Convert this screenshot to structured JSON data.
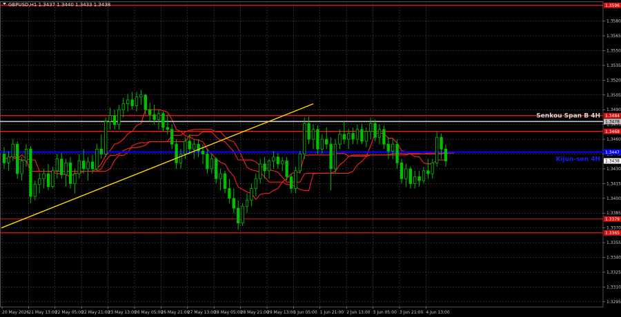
{
  "chart_data": {
    "type": "candlestick",
    "title": "GBPUSD,H1  1.3437 1.3440 1.3433 1.3438",
    "ylim": [
      1.329,
      1.36
    ],
    "y_ticks": [
      "1.3580",
      "1.3565",
      "1.3550",
      "1.3535",
      "1.3520",
      "1.3505",
      "1.3490",
      "1.3475",
      "1.3460",
      "1.3445",
      "1.3430",
      "1.3415",
      "1.3400",
      "1.3385",
      "1.3370",
      "1.3355",
      "1.3340",
      "1.3325",
      "1.3310",
      "1.3295"
    ],
    "x_ticks": [
      "20 May 2026",
      "21 May 13:00",
      "22 May 05:00",
      "22 May 21:00",
      "23 May 13:00",
      "26 May 05:00",
      "26 May 21:00",
      "27 May 13:00",
      "28 May 05:00",
      "28 May 21:00",
      "29 May 13:00",
      "1 Jun 05:00",
      "1 Jun 21:00",
      "2 Jun 13:00",
      "3 Jun 05:00",
      "3 Jun 21:00",
      "4 Jun 13:00"
    ],
    "levels": [
      {
        "price": 1.3596,
        "label": "1.3596",
        "color": "#ff1a1a",
        "width": 1.2
      },
      {
        "price": 1.3484,
        "label": "1.3484",
        "color": "#ff1a1a",
        "width": 1.2
      },
      {
        "price": 1.3468,
        "label": "1.3468",
        "color": "#ff1a1a",
        "width": 1.2
      },
      {
        "price": 1.3379,
        "label": "1.3379",
        "color": "#ff1a1a",
        "width": 0.8
      },
      {
        "price": 1.3365,
        "label": "1.3365",
        "color": "#ff1a1a",
        "width": 1.2
      }
    ],
    "senkou": {
      "price": 1.3478,
      "label": "Senkou Span B 4H",
      "badge": "1.3478",
      "color": "#c8c8c8"
    },
    "kijun": {
      "price": 1.3447,
      "label": "Kijun-sen 4H",
      "badge": "1.3447",
      "color": "#0000ff"
    },
    "current_price": {
      "price": 1.3438,
      "label": "1.3438"
    },
    "trendline": {
      "from": [
        0,
        1.337
      ],
      "to": [
        70,
        1.3496
      ],
      "color": "#ffd700"
    },
    "candle_colors": {
      "up": "#00c000",
      "down": "#00c000"
    },
    "candles": [
      [
        1.3445,
        1.3452,
        1.343,
        1.3436
      ],
      [
        1.3436,
        1.3448,
        1.3428,
        1.3442
      ],
      [
        1.3442,
        1.346,
        1.3438,
        1.3455
      ],
      [
        1.3455,
        1.3458,
        1.342,
        1.3425
      ],
      [
        1.3425,
        1.3442,
        1.3418,
        1.3438
      ],
      [
        1.3438,
        1.3455,
        1.3432,
        1.345
      ],
      [
        1.345,
        1.3453,
        1.3395,
        1.3402
      ],
      [
        1.3402,
        1.3418,
        1.3398,
        1.3414
      ],
      [
        1.3414,
        1.3426,
        1.3405,
        1.342
      ],
      [
        1.342,
        1.343,
        1.341,
        1.3425
      ],
      [
        1.3425,
        1.3435,
        1.3408,
        1.3412
      ],
      [
        1.3412,
        1.3432,
        1.341,
        1.3428
      ],
      [
        1.3428,
        1.3445,
        1.342,
        1.344
      ],
      [
        1.344,
        1.3446,
        1.342,
        1.3424
      ],
      [
        1.3424,
        1.344,
        1.3412,
        1.3436
      ],
      [
        1.3436,
        1.3442,
        1.341,
        1.3415
      ],
      [
        1.3415,
        1.343,
        1.3405,
        1.3425
      ],
      [
        1.3425,
        1.3445,
        1.342,
        1.3438
      ],
      [
        1.3438,
        1.345,
        1.3425,
        1.343
      ],
      [
        1.343,
        1.3442,
        1.3418,
        1.3437
      ],
      [
        1.3437,
        1.3444,
        1.3425,
        1.343
      ],
      [
        1.343,
        1.3455,
        1.3428,
        1.345
      ],
      [
        1.345,
        1.3465,
        1.344,
        1.3445
      ],
      [
        1.3445,
        1.3482,
        1.3442,
        1.3478
      ],
      [
        1.3478,
        1.3492,
        1.347,
        1.3484
      ],
      [
        1.3484,
        1.349,
        1.347,
        1.3475
      ],
      [
        1.3475,
        1.3495,
        1.347,
        1.349
      ],
      [
        1.349,
        1.3502,
        1.3482,
        1.3496
      ],
      [
        1.3496,
        1.3506,
        1.3488,
        1.35
      ],
      [
        1.35,
        1.3508,
        1.349,
        1.3494
      ],
      [
        1.3494,
        1.3508,
        1.3488,
        1.3503
      ],
      [
        1.3503,
        1.351,
        1.3495,
        1.3505
      ],
      [
        1.3505,
        1.3506,
        1.3485,
        1.349
      ],
      [
        1.349,
        1.3497,
        1.3478,
        1.3485
      ],
      [
        1.3485,
        1.3495,
        1.3475,
        1.348
      ],
      [
        1.348,
        1.349,
        1.347,
        1.3486
      ],
      [
        1.3486,
        1.3488,
        1.3468,
        1.3472
      ],
      [
        1.3472,
        1.3485,
        1.3465,
        1.347
      ],
      [
        1.347,
        1.3475,
        1.345,
        1.3455
      ],
      [
        1.3455,
        1.346,
        1.343,
        1.3436
      ],
      [
        1.3436,
        1.345,
        1.343,
        1.3445
      ],
      [
        1.3445,
        1.3462,
        1.344,
        1.3458
      ],
      [
        1.3458,
        1.3465,
        1.3445,
        1.345
      ],
      [
        1.345,
        1.346,
        1.344,
        1.3455
      ],
      [
        1.3455,
        1.346,
        1.3442,
        1.3448
      ],
      [
        1.3448,
        1.3455,
        1.3435,
        1.3445
      ],
      [
        1.3445,
        1.345,
        1.3425,
        1.343
      ],
      [
        1.343,
        1.3445,
        1.3425,
        1.344
      ],
      [
        1.344,
        1.3442,
        1.3415,
        1.342
      ],
      [
        1.342,
        1.343,
        1.3408,
        1.3425
      ],
      [
        1.3425,
        1.3428,
        1.3405,
        1.341
      ],
      [
        1.341,
        1.342,
        1.3395,
        1.34
      ],
      [
        1.34,
        1.341,
        1.3385,
        1.339
      ],
      [
        1.339,
        1.3398,
        1.3368,
        1.3375
      ],
      [
        1.3375,
        1.3395,
        1.3372,
        1.3392
      ],
      [
        1.3392,
        1.3405,
        1.3385,
        1.3398
      ],
      [
        1.3398,
        1.3415,
        1.3392,
        1.341
      ],
      [
        1.341,
        1.3425,
        1.3402,
        1.342
      ],
      [
        1.342,
        1.344,
        1.3415,
        1.3435
      ],
      [
        1.3435,
        1.3442,
        1.342,
        1.3428
      ],
      [
        1.3428,
        1.344,
        1.342,
        1.3438
      ],
      [
        1.3438,
        1.3448,
        1.343,
        1.3442
      ],
      [
        1.3442,
        1.3446,
        1.343,
        1.3435
      ],
      [
        1.3435,
        1.3442,
        1.3428,
        1.3438
      ],
      [
        1.3438,
        1.3442,
        1.3418,
        1.3422
      ],
      [
        1.3422,
        1.3425,
        1.3405,
        1.341
      ],
      [
        1.341,
        1.3432,
        1.3405,
        1.3428
      ],
      [
        1.3428,
        1.3448,
        1.3425,
        1.3445
      ],
      [
        1.3445,
        1.3482,
        1.344,
        1.3476
      ],
      [
        1.3476,
        1.3483,
        1.3455,
        1.346
      ],
      [
        1.346,
        1.3475,
        1.345,
        1.347
      ],
      [
        1.347,
        1.3474,
        1.3445,
        1.345
      ],
      [
        1.345,
        1.3465,
        1.3445,
        1.346
      ],
      [
        1.346,
        1.3472,
        1.345,
        1.3455
      ],
      [
        1.3455,
        1.3462,
        1.3408,
        1.343
      ],
      [
        1.343,
        1.346,
        1.3425,
        1.3455
      ],
      [
        1.3455,
        1.347,
        1.345,
        1.3465
      ],
      [
        1.3465,
        1.3478,
        1.3455,
        1.346
      ],
      [
        1.346,
        1.347,
        1.345,
        1.3466
      ],
      [
        1.3466,
        1.3472,
        1.3455,
        1.346
      ],
      [
        1.346,
        1.3475,
        1.3455,
        1.347
      ],
      [
        1.347,
        1.3476,
        1.3455,
        1.3458
      ],
      [
        1.3458,
        1.3472,
        1.3452,
        1.3468
      ],
      [
        1.3468,
        1.3482,
        1.346,
        1.3476
      ],
      [
        1.3476,
        1.348,
        1.3458,
        1.3462
      ],
      [
        1.3462,
        1.3475,
        1.3455,
        1.347
      ],
      [
        1.347,
        1.3474,
        1.345,
        1.3455
      ],
      [
        1.3455,
        1.3462,
        1.344,
        1.3448
      ],
      [
        1.3448,
        1.346,
        1.344,
        1.3455
      ],
      [
        1.3455,
        1.346,
        1.343,
        1.3436
      ],
      [
        1.3436,
        1.344,
        1.3415,
        1.342
      ],
      [
        1.342,
        1.3435,
        1.3412,
        1.343
      ],
      [
        1.343,
        1.3432,
        1.341,
        1.3415
      ],
      [
        1.3415,
        1.3428,
        1.341,
        1.3422
      ],
      [
        1.3422,
        1.3428,
        1.3412,
        1.3418
      ],
      [
        1.3418,
        1.3432,
        1.3415,
        1.3428
      ],
      [
        1.3428,
        1.344,
        1.342,
        1.3425
      ],
      [
        1.3425,
        1.344,
        1.342,
        1.3436
      ],
      [
        1.3436,
        1.3468,
        1.3432,
        1.3462
      ],
      [
        1.3462,
        1.3466,
        1.344,
        1.345
      ],
      [
        1.345,
        1.3455,
        1.3432,
        1.3438
      ]
    ]
  }
}
